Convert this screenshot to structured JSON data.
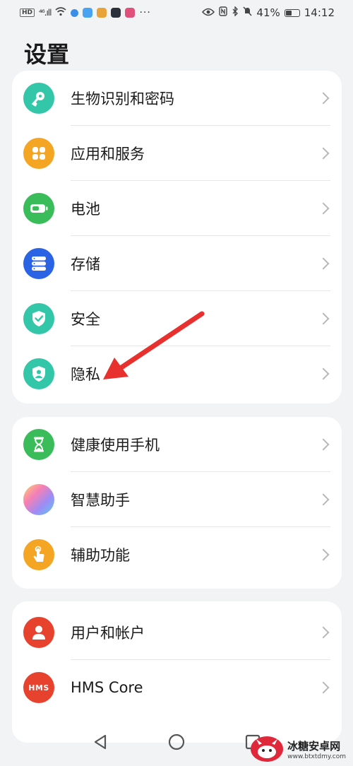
{
  "status_bar": {
    "hd": "HD",
    "signal": "⁴⁶.ıll",
    "battery_percent": "41%",
    "time": "14:12",
    "more": "···"
  },
  "page": {
    "title": "设置"
  },
  "groups": [
    {
      "items": [
        {
          "label": "生物识别和密码",
          "icon": "key-icon",
          "color": "#34c6a8"
        },
        {
          "label": "应用和服务",
          "icon": "apps-icon",
          "color": "#f5a524"
        },
        {
          "label": "电池",
          "icon": "battery-icon",
          "color": "#3bbc5b"
        },
        {
          "label": "存储",
          "icon": "storage-icon",
          "color": "#2a63e3"
        },
        {
          "label": "安全",
          "icon": "shield-check-icon",
          "color": "#34c6a8"
        },
        {
          "label": "隐私",
          "icon": "privacy-icon",
          "color": "#34c6a8"
        }
      ]
    },
    {
      "items": [
        {
          "label": "健康使用手机",
          "icon": "hourglass-icon",
          "color": "#3bbc5b"
        },
        {
          "label": "智慧助手",
          "icon": "assistant-orb-icon",
          "color": "#b78cf2"
        },
        {
          "label": "辅助功能",
          "icon": "hand-icon",
          "color": "#f5a524"
        }
      ]
    },
    {
      "items": [
        {
          "label": "用户和帐户",
          "icon": "user-icon",
          "color": "#e6422e"
        },
        {
          "label": "HMS Core",
          "icon": "hms-icon",
          "icon_text": "HMS",
          "color": "#e6422e"
        }
      ]
    }
  ],
  "watermark": {
    "text": "冰糖安卓网",
    "url": "www.btxtdmy.com"
  },
  "annotation": {
    "arrow_color": "#e8302f"
  }
}
